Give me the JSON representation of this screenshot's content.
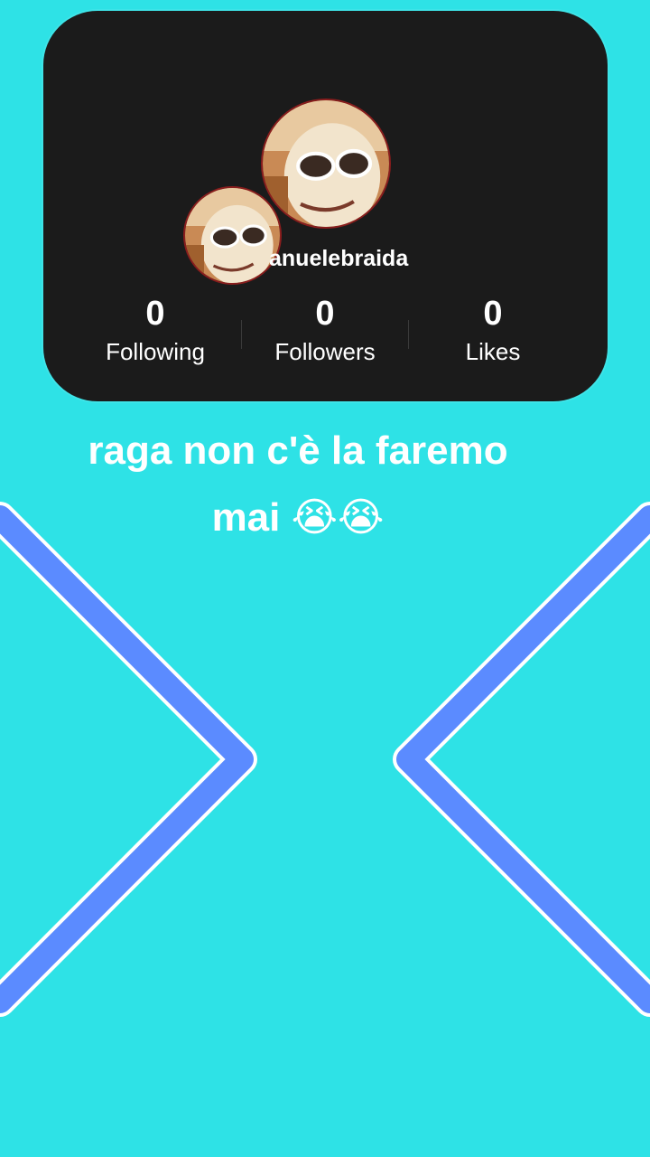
{
  "profile": {
    "username": "anuelebraida"
  },
  "stats": [
    {
      "value": "0",
      "label": "Following"
    },
    {
      "value": "0",
      "label": "Followers"
    },
    {
      "value": "0",
      "label": "Likes"
    }
  ],
  "caption": {
    "line1": "raga non c'è la faremo",
    "line2": "mai 😭😭"
  },
  "colors": {
    "background": "#2ee2e6",
    "card": "#1b1b1b",
    "chevron": "#5b8bff"
  },
  "icons": [
    "avatar-photo",
    "crying-face-emoji"
  ]
}
